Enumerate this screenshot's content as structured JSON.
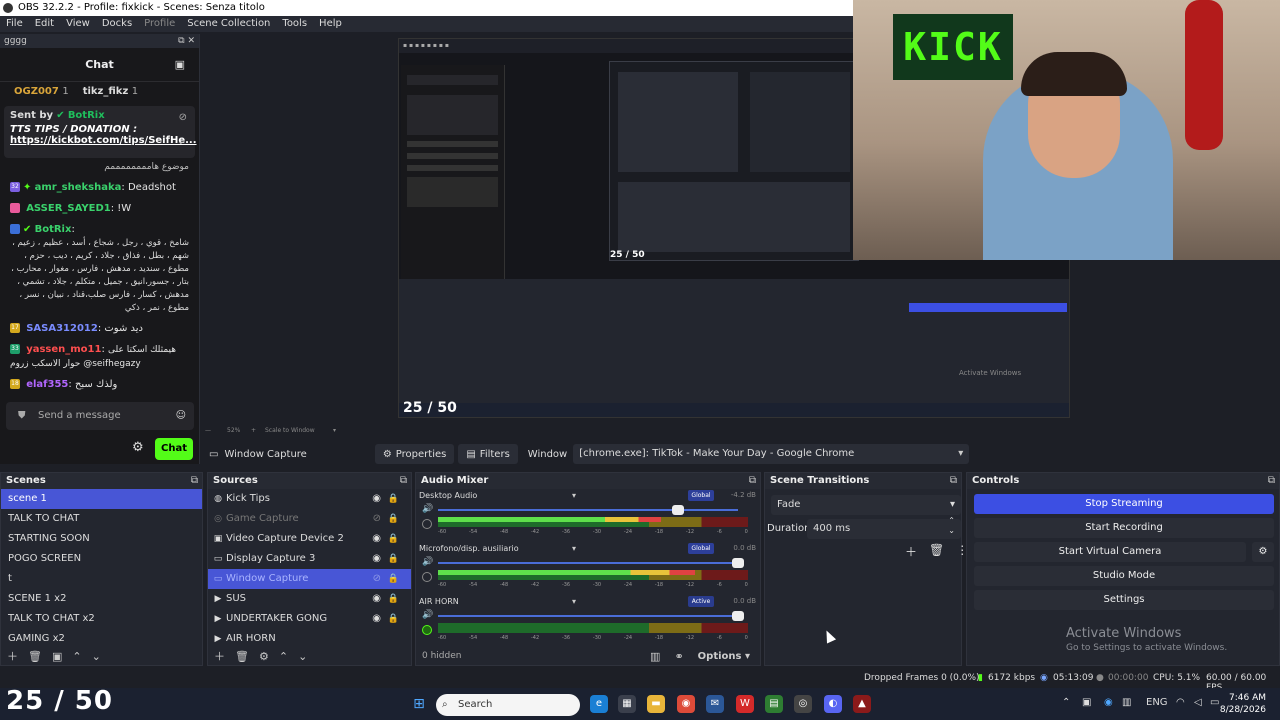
{
  "window": {
    "title": "OBS 32.2.2 - Profile: fixkick - Scenes: Senza titolo"
  },
  "menu": [
    {
      "label": "File"
    },
    {
      "label": "Edit"
    },
    {
      "label": "View"
    },
    {
      "label": "Docks"
    },
    {
      "label": "Profile"
    },
    {
      "label": "Scene Collection"
    },
    {
      "label": "Tools"
    },
    {
      "label": "Help"
    }
  ],
  "chat": {
    "dock_title": "gggg",
    "title": "Chat",
    "leaders": [
      "OGZ007",
      "1",
      "tikz_fikz",
      "1"
    ],
    "pinned": {
      "sent_by": "Sent by",
      "bot": "BotRix",
      "tts": "TTS TIPS / DONATION :",
      "link": "https://kickbot.com/tips/SeifHe..."
    },
    "messages": [
      {
        "text": "موضوع هاممممممممم"
      },
      {
        "badge": "32",
        "user": "amr_shekshaka",
        "text": "Deadshot"
      },
      {
        "user": "ASSER_SAYED1",
        "text": "!W"
      },
      {
        "user": "BotRix",
        "text": "شامخ ، قوي ، رجل ، شجاع ، أسد ، عظيم ، زعيم ، شهم ، بطل ، فذاق ، جلاد ، كريم ، ديب ، حزم ، مطوع ، سنديد ، مدهش ، فارس ، مغوار ، محارب ، بتار ، جسور،انيق ، جميل ، متكلم ، جلاد ، تشمي ، مدهش ، كسار ، فارس صلب،قناد ، نبيان ، نسر ، مطوع ، نمر ، ذكي"
      },
      {
        "badge": "17",
        "user": "SASA312012",
        "text": "ديد شوت"
      },
      {
        "badge": "33",
        "user": "yassen_mo11",
        "text": "هيمثلك اسكتا على حوار الاسكب زروم @seifhegazy"
      },
      {
        "badge": "18",
        "user": "elaf355",
        "text": "ولذك سبح"
      }
    ],
    "input_placeholder": "Send a message",
    "send_label": "Chat"
  },
  "preview": {
    "counter": "25 / 50",
    "zoom": "52%",
    "scale_mode": "Scale to Window",
    "activate_title": "Activate Windows",
    "activate_sub": "Go to Settings to activate Windows."
  },
  "source_toolbar": {
    "source_name": "Window Capture",
    "properties": "Properties",
    "filters": "Filters",
    "window_label": "Window",
    "window_value": "[chrome.exe]: TikTok - Make Your Day - Google Chrome"
  },
  "scenes": {
    "title": "Scenes",
    "items": [
      "scene 1",
      "TALK TO CHAT",
      "STARTING SOON",
      "POGO SCREEN",
      "t",
      "SCENE 1 x2",
      "TALK TO CHAT x2",
      "GAMING x2"
    ],
    "selected": 0
  },
  "sources": {
    "title": "Sources",
    "items": [
      {
        "name": "Kick Tips",
        "icon": "globe-icon",
        "visible": true
      },
      {
        "name": "Game Capture",
        "icon": "gamepad-icon",
        "visible": false
      },
      {
        "name": "Video Capture Device 2",
        "icon": "camera-icon",
        "visible": true
      },
      {
        "name": "Display Capture 3",
        "icon": "monitor-icon",
        "visible": true
      },
      {
        "name": "Window Capture",
        "icon": "window-icon",
        "visible": false,
        "selected": true
      },
      {
        "name": "SUS",
        "icon": "play-icon",
        "visible": true
      },
      {
        "name": "UNDERTAKER GONG",
        "icon": "play-icon",
        "visible": true
      },
      {
        "name": "AIR HORN",
        "icon": "play-icon",
        "visible": true
      }
    ]
  },
  "mixer": {
    "title": "Audio Mixer",
    "tracks": [
      {
        "name": "Desktop Audio",
        "tag": "Global",
        "db": "-4.2 dB",
        "volume": 0.8,
        "level": 0.72
      },
      {
        "name": "Microfono/disp. ausiliario",
        "tag": "Global",
        "db": "0.0 dB",
        "volume": 1.0,
        "level": 0.83
      },
      {
        "name": "AIR HORN",
        "tag": "Active",
        "db": "0.0 dB",
        "volume": 1.0,
        "level": 0.0
      }
    ],
    "scale": [
      "-60",
      "-54",
      "-48",
      "-42",
      "-36",
      "-30",
      "-24",
      "-18",
      "-12",
      "-6",
      "0"
    ],
    "hidden": "0 hidden",
    "options": "Options"
  },
  "transitions": {
    "title": "Scene Transitions",
    "type": "Fade",
    "duration_label": "Duration",
    "duration_value": "400 ms"
  },
  "controls": {
    "title": "Controls",
    "buttons": [
      "Stop Streaming",
      "Start Recording",
      "Start Virtual Camera",
      "Studio Mode",
      "Settings"
    ]
  },
  "status": {
    "dropped": "Dropped Frames 0 (0.0%)",
    "bitrate": "6172 kbps",
    "stream_time": "05:13:09",
    "rec_time": "00:00:00",
    "cpu": "CPU: 5.1%",
    "fps": "60.00 / 60.00 FPS"
  },
  "taskbar": {
    "counter": "25 / 50",
    "search": "Search",
    "lang": "ENG",
    "time": "7:46 AM",
    "date": "8/28/2026"
  },
  "colors": {
    "accent": "#4856d6",
    "kick_green": "#53fc18",
    "stream_button": "#3c4fe3"
  }
}
